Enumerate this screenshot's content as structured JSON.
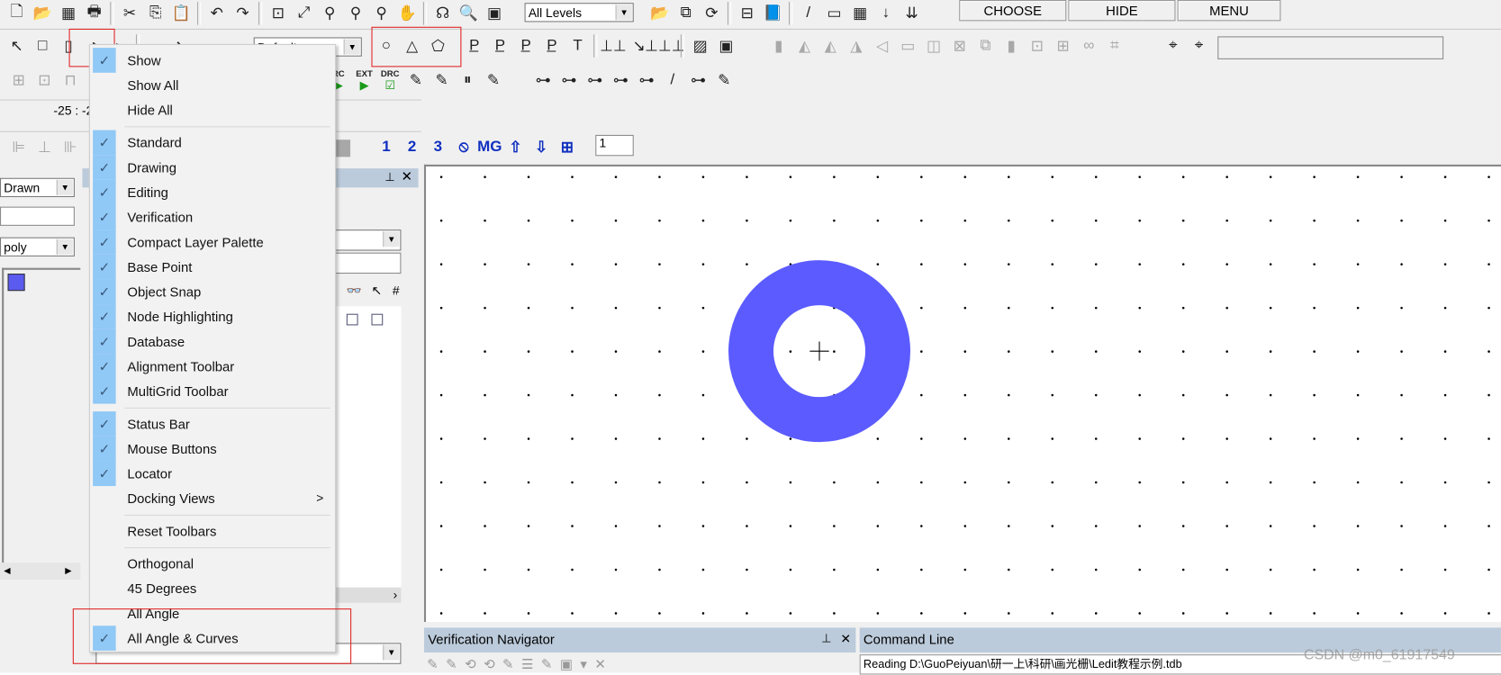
{
  "toolbar_row1": {
    "icons": [
      "new-file",
      "open-folder",
      "save-all",
      "print",
      "|",
      "cut",
      "copy",
      "paste",
      "|",
      "undo",
      "redo",
      "|",
      "zoom-box",
      "zoom-fit",
      "find",
      "binoculars-up",
      "binoculars-down",
      "hand-xy",
      "|",
      "hierarchy",
      "magnifier",
      "chip"
    ],
    "icons_glyph": [
      "🗋",
      "📂",
      "▦",
      "🖶",
      "|",
      "✂",
      "⎘",
      "📋",
      "|",
      "↶",
      "↷",
      "|",
      "⊡",
      "⤢",
      "⚲",
      "⚲",
      "⚲",
      "✋",
      "|",
      "☊",
      "🔍",
      "▣"
    ],
    "levels_select": "All Levels",
    "icons2_glyph": [
      "📂",
      "⧉",
      "⟳",
      "|",
      "⊟",
      "📘",
      "|",
      "/",
      "▭",
      "▦",
      "↓",
      "⇊"
    ],
    "icons2": [
      "open-cell",
      "copy-cell",
      "refresh",
      "|",
      "ruler",
      "book",
      "|",
      "line",
      "save",
      "stack",
      "move-down",
      "move-down-all"
    ],
    "buttons": [
      "CHOOSE",
      "HIDE",
      "MENU"
    ]
  },
  "toolbar_row2": {
    "left_glyph": [
      "↖",
      "□",
      "▯",
      "◗",
      "▸",
      "|",
      "⌐",
      "➘"
    ],
    "left": [
      "select-arrow",
      "box",
      "rect-tool",
      "arc",
      "pointer",
      "|",
      "wire",
      "arrow"
    ],
    "style_select": "Default",
    "shapes_glyph": [
      "○",
      "△",
      "⬠"
    ],
    "shapes": [
      "circle",
      "polygon",
      "curved-polygon"
    ],
    "port_glyph": [
      "P̲",
      "P̲",
      "P̲",
      "P̲",
      "T",
      "|",
      "⊥⊥",
      "↘",
      "⊥⊥⊥",
      "|",
      "▨",
      "▣"
    ],
    "port": [
      "port-box",
      "port-l",
      "port-r",
      "port-tri",
      "text",
      "|",
      "ruler",
      "angle",
      "ruler-2",
      "|",
      "layer-a",
      "layer-b"
    ],
    "edit_glyph": [
      "▮",
      "◭",
      "◭",
      "◮",
      "◁",
      "▭",
      "◫",
      "⊠",
      "⧉",
      "▮",
      "⊡",
      "⊞",
      "∞",
      "⌗"
    ],
    "edit": [
      "copy",
      "rotate",
      "rotate-ccw",
      "flip",
      "flip-h",
      "align-bottom",
      "align-center",
      "delete-box",
      "duplicate",
      "mirror",
      "bound",
      "group",
      "chain",
      "snap"
    ],
    "snap_glyph": [
      "⌖",
      "⌖"
    ],
    "snap": [
      "locate",
      "locate-cursor"
    ]
  },
  "toolbar_row3": {
    "left_glyph": [
      "⊞",
      "⊡",
      "⊓"
    ],
    "left": [
      "node-edit",
      "node-box",
      "node-corner"
    ],
    "drc_glyph": [
      "▶",
      "▶",
      "☑",
      "✎",
      "✎",
      "⏸",
      "✎"
    ],
    "drc_labels": [
      "RC",
      "EXT",
      "DRC",
      "",
      "",
      "",
      ""
    ],
    "drc": [
      "run-rc",
      "extract",
      "drc-check",
      "wrench-1",
      "wrench-2",
      "run-stop",
      "wrench-3"
    ],
    "nav_glyph": [
      "⊶",
      "⊶",
      "⊶",
      "⊶",
      "⊶",
      "/",
      "⊶",
      "✎"
    ],
    "nav": [
      "nav-1",
      "nav-2",
      "nav-3",
      "nav-4",
      "nav-5",
      "nav-6",
      "nav-7",
      "nav-8"
    ]
  },
  "coords": "-25 : -2",
  "toolbar_row5": {
    "align_glyph": [
      "⊫",
      "⊥",
      "⊪"
    ],
    "align": [
      "align-left",
      "align-center",
      "align-right"
    ],
    "grid_glyph": [
      "1",
      "2",
      "3",
      "⦸",
      "MG",
      "⇧",
      "⇩",
      "⊞"
    ],
    "grid": [
      "grid-1",
      "grid-2",
      "grid-3",
      "no-grid",
      "multigrid",
      "grid-up",
      "grid-down",
      "grid-save"
    ],
    "grid_value": "1"
  },
  "left_panel": {
    "mode_select": "Drawn",
    "name_input": "",
    "type_select": "poly",
    "layer_color": "#5b5bf0"
  },
  "canvas": {
    "shape_color": "#5b5bff",
    "grid_dot_color": "#000000"
  },
  "verification_navigator": {
    "title": "Verification Navigator"
  },
  "command_line": {
    "title": "Command Line",
    "text": "Reading D:\\GuoPeiyuan\\研一上\\科研\\画光栅\\Ledit教程示例.tdb"
  },
  "watermark": "CSDN @m0_61917549",
  "context_menu": {
    "items": [
      {
        "label": "Show",
        "checked": true
      },
      {
        "label": "Show All",
        "checked": false
      },
      {
        "label": "Hide All",
        "checked": false
      },
      {
        "sep": true
      },
      {
        "label": "Standard",
        "checked": true
      },
      {
        "label": "Drawing",
        "checked": true
      },
      {
        "label": "Editing",
        "checked": true
      },
      {
        "label": "Verification",
        "checked": true
      },
      {
        "label": "Compact Layer Palette",
        "checked": true
      },
      {
        "label": "Base Point",
        "checked": true
      },
      {
        "label": "Object Snap",
        "checked": true
      },
      {
        "label": "Node Highlighting",
        "checked": true
      },
      {
        "label": "Database",
        "checked": true
      },
      {
        "label": "Alignment Toolbar",
        "checked": true
      },
      {
        "label": "MultiGrid Toolbar",
        "checked": true
      },
      {
        "sep": true
      },
      {
        "label": "Status Bar",
        "checked": true
      },
      {
        "label": "Mouse Buttons",
        "checked": true
      },
      {
        "label": "Locator",
        "checked": true
      },
      {
        "label": "Docking Views",
        "checked": false,
        "submenu": true
      },
      {
        "sep": true
      },
      {
        "label": "Reset Toolbars",
        "checked": false
      },
      {
        "sep": true
      },
      {
        "label": "Orthogonal",
        "checked": false
      },
      {
        "label": "45 Degrees",
        "checked": false
      },
      {
        "label": "All Angle",
        "checked": false
      },
      {
        "label": "All Angle & Curves",
        "checked": true
      }
    ],
    "check_glyph": "✓",
    "submenu_glyph": ">"
  }
}
